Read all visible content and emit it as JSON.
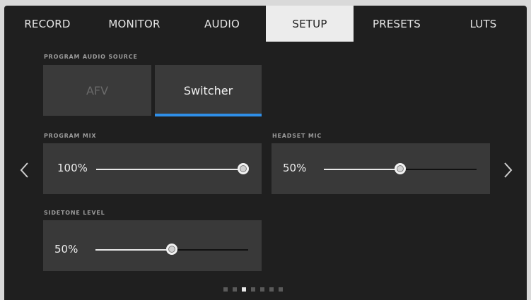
{
  "tabs": [
    {
      "label": "RECORD",
      "active": false
    },
    {
      "label": "MONITOR",
      "active": false
    },
    {
      "label": "AUDIO",
      "active": false
    },
    {
      "label": "SETUP",
      "active": true
    },
    {
      "label": "PRESETS",
      "active": false
    },
    {
      "label": "LUTS",
      "active": false
    }
  ],
  "program_audio_source": {
    "label": "PROGRAM AUDIO SOURCE",
    "options": [
      {
        "label": "AFV",
        "selected": false
      },
      {
        "label": "Switcher",
        "selected": true
      }
    ]
  },
  "program_mix": {
    "label": "PROGRAM MIX",
    "value_text": "100%",
    "value": 1.0
  },
  "headset_mic": {
    "label": "HEADSET MIC",
    "value_text": "50%",
    "value": 0.5
  },
  "sidetone_level": {
    "label": "SIDETONE LEVEL",
    "value_text": "50%",
    "value": 0.5
  },
  "pager": {
    "count": 7,
    "active_index": 2
  },
  "icons": {
    "prev": "chevron-left-icon",
    "next": "chevron-right-icon"
  },
  "colors": {
    "accent": "#2f8fe8",
    "active_tab_bg": "#ececec",
    "panel_bg": "#393939",
    "screen_bg": "#1f1f1f"
  }
}
